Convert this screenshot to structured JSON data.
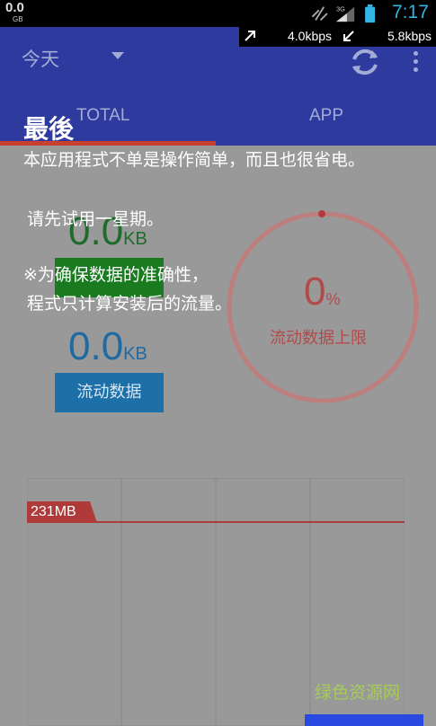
{
  "status_bar": {
    "data_value": "0.0",
    "data_unit": "GB",
    "time": "7:17",
    "icons": [
      "data-transfer-icon",
      "3g-signal-icon",
      "battery-icon"
    ]
  },
  "speed": {
    "upload": "4.0kbps",
    "download": "5.8kbps"
  },
  "app_bar": {
    "period": "今天",
    "refresh_icon": "refresh-icon",
    "more_icon": "overflow-menu-icon"
  },
  "tabs": [
    {
      "label": "TOTAL",
      "selected": true
    },
    {
      "label": "APP",
      "selected": false
    }
  ],
  "usage": {
    "first_value": "0.0",
    "first_unit": "KB",
    "second_value": "0.0",
    "second_unit": "KB",
    "mobile_data_button": "流动数据"
  },
  "limit_ring": {
    "percent": "0",
    "percent_unit": "%",
    "label": "流动数据上限"
  },
  "chart": {
    "limit_label": "231MB"
  },
  "watermark": "绿色资源网",
  "overlay": {
    "title": "最後",
    "line1": "本应用程式不单是操作简单，而且也很省电。",
    "line2": "请先试用一星期。",
    "line3": "※为确保数据的准确性，",
    "line4": "程式只计算安装后的流量。"
  },
  "colors": {
    "app_bar": "#2e3a9e",
    "tab_indicator": "#c9402f",
    "ring": "#c97676",
    "accent_blue": "#1d6fa8",
    "time": "#33b5e5"
  }
}
